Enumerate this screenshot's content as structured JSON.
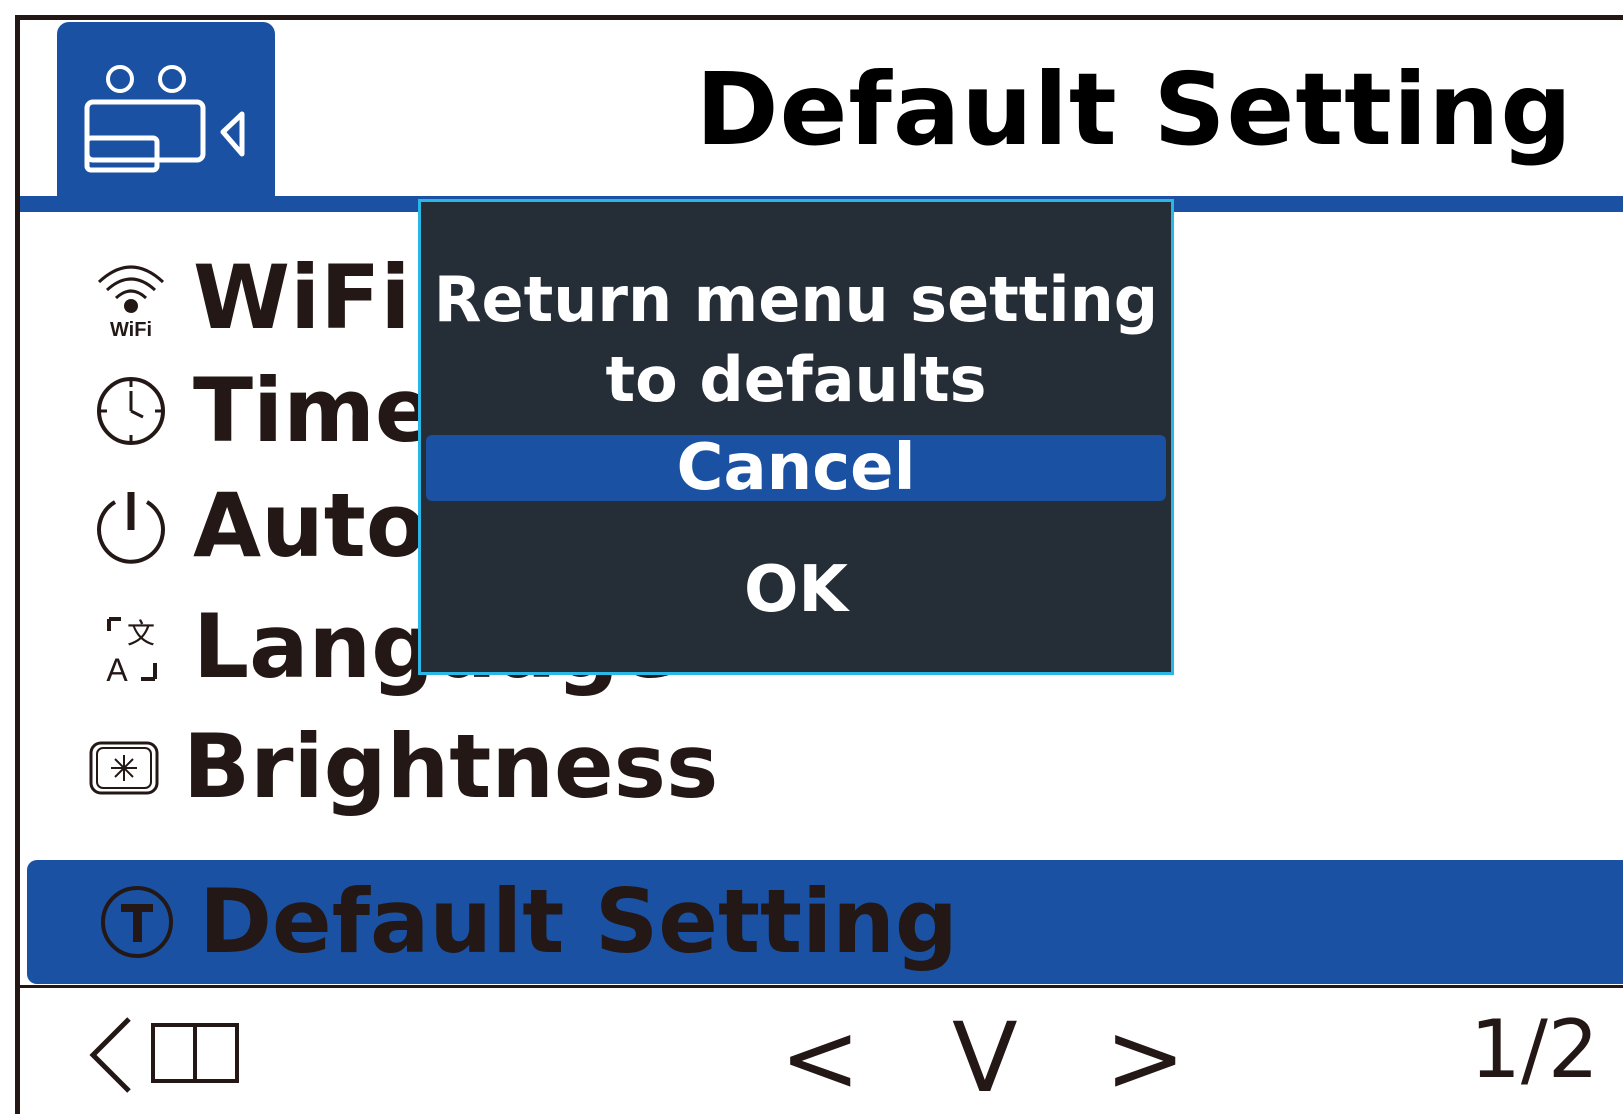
{
  "header": {
    "title": "Default Setting",
    "mode_icon": "camera-car-icon"
  },
  "menu": {
    "items": [
      {
        "label": "WiFi",
        "icon": "wifi-icon",
        "icon_caption": "WiFi"
      },
      {
        "label": "Time",
        "icon": "clock-icon"
      },
      {
        "label": "Auto",
        "icon": "power-icon"
      },
      {
        "label": "Language",
        "icon": "language-icon"
      },
      {
        "label": "Brightness",
        "icon": "brightness-icon"
      },
      {
        "label": "Default Setting",
        "icon": "reset-icon"
      }
    ],
    "selected_index": 5
  },
  "dialog": {
    "message_line1": "Return menu setting",
    "message_line2": "to defaults",
    "options": [
      "Cancel",
      "OK"
    ],
    "focused_option": "Cancel"
  },
  "footer": {
    "back": "back-icon",
    "prev": "<",
    "confirm": "V",
    "next": ">",
    "page": "1/2"
  },
  "colors": {
    "accent": "#1b51a3",
    "dialog_bg": "#252d37",
    "dialog_border": "#2ab7e6",
    "text": "#231815"
  }
}
